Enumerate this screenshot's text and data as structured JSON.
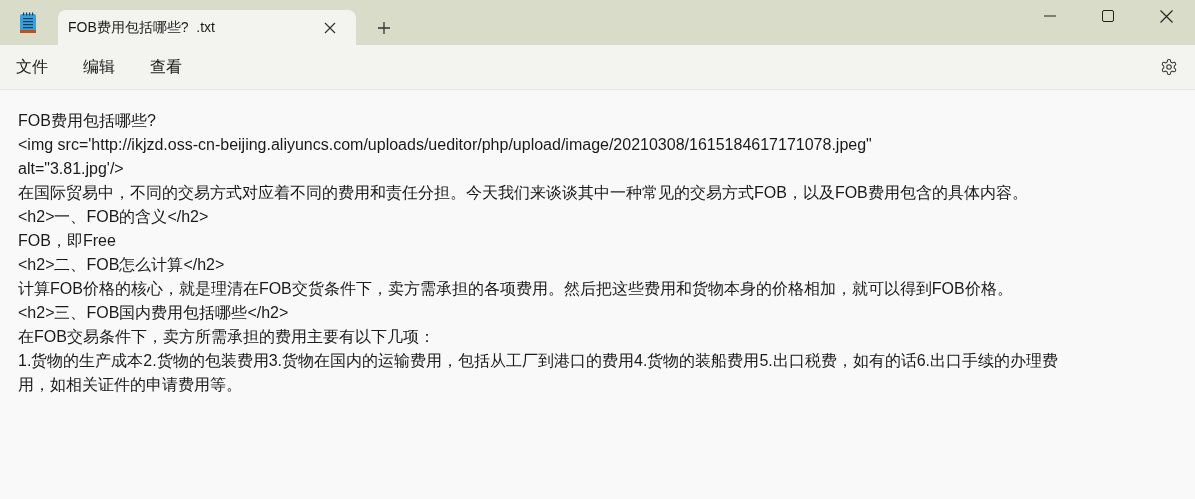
{
  "tabs": [
    {
      "label": "FOB费用包括哪些?  .txt",
      "selected": true
    }
  ],
  "menu": [
    "文件",
    "编辑",
    "查看"
  ],
  "lines": [
    "FOB费用包括哪些?",
    "<img src='http://ikjzd.oss-cn-beijing.aliyuncs.com/uploads/ueditor/php/upload/image/20210308/1615184617171078.jpeg\"",
    "alt=\"3.81.jpg'/>",
    "在国际贸易中，不同的交易方式对应着不同的费用和责任分担。今天我们来谈谈其中一种常见的交易方式FOB，以及FOB费用包含的具体内容。",
    "<h2>一、FOB的含义</h2>",
    "FOB，即Free",
    "<h2>二、FOB怎么计算</h2>",
    "计算FOB价格的核心，就是理清在FOB交货条件下，卖方需承担的各项费用。然后把这些费用和货物本身的价格相加，就可以得到FOB价格。",
    "<h2>三、FOB国内费用包括哪些</h2>",
    "在FOB交易条件下，卖方所需承担的费用主要有以下几项：",
    "1.货物的生产成本2.货物的包装费用3.货物在国内的运输费用，包括从工厂到港口的费用4.货物的装船费用5.出口税费，如有的话6.出口手续的办理费",
    "用，如相关证件的申请费用等。"
  ]
}
